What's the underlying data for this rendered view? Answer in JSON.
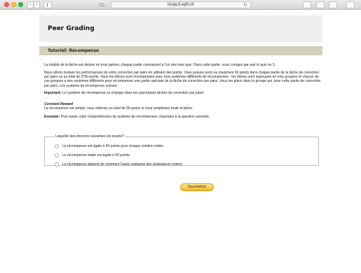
{
  "browser": {
    "url": "ilsspc3.epfl.ch",
    "reload_glyph": "↻",
    "back_glyph": "‹",
    "forward_glyph": "›"
  },
  "header": {
    "title": "Peer Grading"
  },
  "section": {
    "title": "Tutoriel: Récompense"
  },
  "content": {
    "intro": "La totalité de la tâche est divisée en trois parties; chaque partie correspond à l'un des trois quiz. Dans cette partie, vous corrigez par pair le quiz no 3.",
    "description": "Nous allons évaluer les performances de votre correction par pairs en utilisant des points. Vous pouvez avoir au maximum 50 points dans chaque partie de la tâche de correction par pairs ou au total de 3*50 points. Vous les élèves sont récompensés avec trois systèmes différents de récompenses - les élèves sont regroupés en trois groupes et chacun de ces groupes a des systèmes différents pour récompenser une partie spéciale de la tâche de correction par pairs. Vous les placé dans le groupe qui, pour cette partie de correction par pairs, a le système de récompense suivant.",
    "important_label": "Important:",
    "important_text": " Le système de récompense va changer dans les prochaines tâches de correction par pairs!",
    "reward_heading": "Constant Reward",
    "reward_text": "La récompense est simple: vous obtenez un total de 50 points si vous remplissez toute la tâche.",
    "example_label": "Exemple:",
    "example_text": " Pour tester votre compréhension du système de récompenses, répondez à la question suivante."
  },
  "question": {
    "legend": "Laquelle des énoncés suivantes est exacte?",
    "options": [
      "La récompense est égale à 50 points pour chaque solution notée.",
      "La récompense totale est égale à 50 points.",
      "La récompense dépend de comment l'autre catégorie des évaluateurs notent."
    ]
  },
  "submit_label": "Soumettre",
  "colors": {
    "section_bar": "#d4d0b8",
    "header_bg": "#efefef",
    "submit_button": "#f6b623"
  }
}
